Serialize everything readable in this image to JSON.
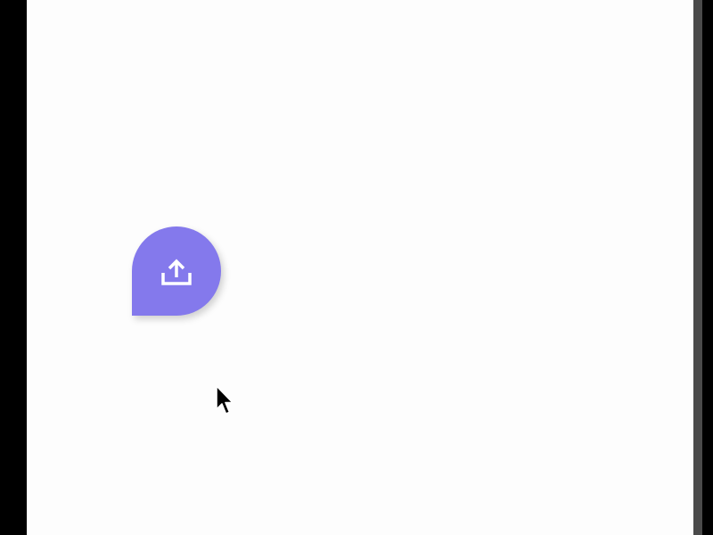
{
  "theme": {
    "screen_background": "#fdfdfd",
    "frame_color": "#000000",
    "fab_color": "#8479ec",
    "icon_color": "#ffffff"
  },
  "fab": {
    "icon": "upload-icon",
    "shape": "teardrop"
  },
  "cursor": {
    "icon": "mouse-pointer-icon"
  }
}
